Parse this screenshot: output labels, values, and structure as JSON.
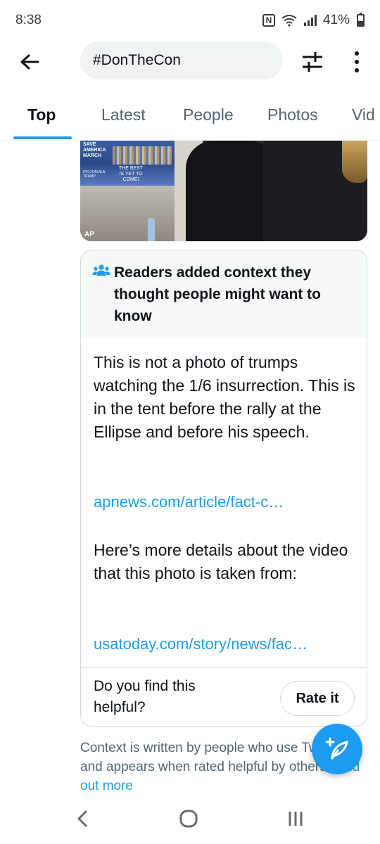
{
  "status_bar": {
    "time": "8:38",
    "nfc_label": "N",
    "battery_percent": "41%",
    "battery_level": 0.41
  },
  "top_bar": {
    "search_query": "#DonTheCon",
    "back_icon": "arrow-left-icon",
    "filter_icon": "sliders-icon",
    "more_icon": "more-vertical-icon"
  },
  "tabs": [
    {
      "label": "Top",
      "active": true
    },
    {
      "label": "Latest",
      "active": false
    },
    {
      "label": "People",
      "active": false
    },
    {
      "label": "Photos",
      "active": false
    },
    {
      "label": "Vid",
      "active": false
    }
  ],
  "media": {
    "tv_text_top": "SAVE AMERICA MARCH",
    "tv_text_sign": "THE BEST IS YET TO COME!",
    "tv_text_bottom": "PFI.COM ALA TRUMP",
    "credit": "AP"
  },
  "note": {
    "header_icon": "people-group-icon",
    "header_text": "Readers added context they thought people might want to know",
    "body_1": "This is not a photo of trumps watching the 1/6 insurrection. This is in the tent before the rally at the Ellipse and before his speech.",
    "link_1": "apnews.com/article/fact-c…",
    "body_2": "Here’s more details about the video that this photo is taken from:",
    "link_2": "usatoday.com/story/news/fac…",
    "helpful_question": "Do you find this helpful?",
    "rate_label": "Rate it"
  },
  "footer": {
    "context_text": "Context is written by people who use Twitter, and appears when rated helpful by others.",
    "find_out_more": "Find out more"
  },
  "fab": {
    "icon": "compose-feather-plus-icon"
  },
  "nav_bar": {
    "back_icon": "nav-back-icon",
    "home_icon": "nav-home-icon",
    "recents_icon": "nav-recents-icon"
  },
  "colors": {
    "accent": "#1d9bf0",
    "text_primary": "#0f1419",
    "text_secondary": "#536471",
    "border": "#cfd9de",
    "pill_bg": "#eff3f4",
    "note_header_bg": "#f7f9f9"
  }
}
